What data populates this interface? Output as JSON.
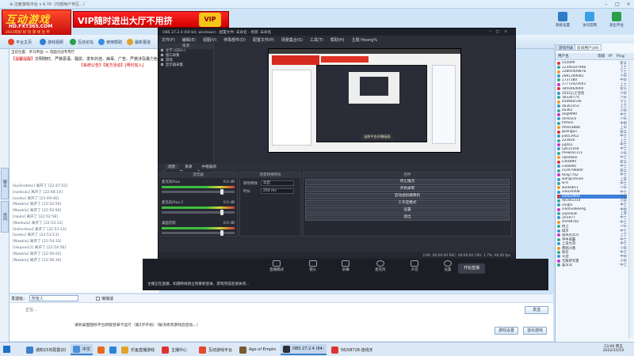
{
  "window": {
    "title": "⊕ 注册游戏平台 v 4.70（内部用户专区...）"
  },
  "brand": {
    "logo_text": "互动游戏",
    "logo_url": "HD.FXT365.COM",
    "logo_slogan": "2023年好 好 玩 游 戏 出 平",
    "banner_text": "VIP随时进出大厅不用挤",
    "banner_badge": "VIP"
  },
  "nav": {
    "items": [
      {
        "label": "平台主页",
        "color": "#e5482c"
      },
      {
        "label": "游戏视频",
        "color": "#2c7fd3"
      },
      {
        "label": "互动论坛",
        "color": "#2c9f4b"
      },
      {
        "label": "使用帮助",
        "color": "#3a8ee0"
      },
      {
        "label": "最新报道",
        "color": "#e0a32a"
      }
    ]
  },
  "top_right": [
    {
      "label": "系统设置"
    },
    {
      "label": "访问官网"
    },
    {
      "label": "退出平台"
    }
  ],
  "room": {
    "breadcrumb": "当前位置：罗马帝国 -> 电脑对战专用厅",
    "notice_label": "【温馨提醒】",
    "notice_text": "文明随时、严禁恶语、骚扰、发布外挂、病毒、广告、严禁涉及暴力色情、违反者将封号处理！",
    "notice_red": "【系统公告】【官方活动】[明日加入]",
    "left_tabs": [
      "聊天",
      "房间"
    ],
    "chat": [
      "[kuilinebloc] 离开了 [22:47:52]",
      "[nankulu] 离开了 [22:48:14]",
      "[sooku] 离开了 [22:49:46]",
      "[Nawklu] 离开了 [22:52:56]",
      "[Nawklu] 离开了 [22:52:56]",
      "[nkulo] 离开了 [22:52:58]",
      "[Nankulu] 离开了 [22:53:12]",
      "[lisklunkau] 离开了 [22:53:13]",
      "[sooku] 离开了 [22:53:13]",
      "[Nawklu] 离开了 [22:54:33]",
      "[nkupoo11] 离开了 [22:54:56]",
      "[Nawklu] 离开了 [22:56:02]",
      "[Nawklu] 离开了 [22:56:34]"
    ]
  },
  "sendbar": {
    "to_label": "发送给：",
    "to_value": "所有人",
    "private_label": "悄悄话",
    "send_label": "发送"
  },
  "inputarea": {
    "status_text": "正在...",
    "room_info": "请到桌面图标平台新版登录卡运行（第2步开始）（解决修改游戏后启动...）",
    "room_btn1": "游戏设置",
    "room_btn2": "退出游戏"
  },
  "right_panel": {
    "tabs": [
      "游戏列表",
      "房间用户(49)"
    ],
    "head": [
      "用户名",
      "等级",
      "IP",
      "Ping"
    ],
    "users": [
      {
        "name": "555009",
        "lv": "新兵",
        "color": "#d33"
      },
      {
        "name": "12340207998",
        "lv": "上士",
        "color": "#3a9"
      },
      {
        "name": "12805409878",
        "lv": "下士",
        "color": "#e92"
      },
      {
        "name": "2891309082",
        "lv": "少校",
        "color": "#39c"
      },
      {
        "name": "1737180",
        "lv": "中尉",
        "color": "#3a9"
      },
      {
        "name": "17772421603",
        "lv": "上士",
        "color": "#c3c"
      },
      {
        "name": "1850464000",
        "lv": "新兵",
        "color": "#d33"
      },
      {
        "name": "2022心之泡泡",
        "lv": "少校",
        "color": "#39c"
      },
      {
        "name": "38326774",
        "lv": "少校",
        "color": "#3a9"
      },
      {
        "name": "450660536",
        "lv": "下士",
        "color": "#e92"
      },
      {
        "name": "a6361553",
        "lv": "上士",
        "color": "#39c"
      },
      {
        "name": "aa362",
        "lv": "少校",
        "color": "#3a9"
      },
      {
        "name": "ang9999",
        "lv": "中士",
        "color": "#c3c"
      },
      {
        "name": "dcmoica",
        "lv": "少校",
        "color": "#39c"
      },
      {
        "name": "flsmen",
        "lv": "中尉",
        "color": "#3a9"
      },
      {
        "name": "flmoca888",
        "lv": "上等",
        "color": "#e92"
      },
      {
        "name": "guangyu",
        "lv": "新兵",
        "color": "#d33"
      },
      {
        "name": "jia653952",
        "lv": "中士",
        "color": "#39c"
      },
      {
        "name": "223834",
        "lv": "上士",
        "color": "#3a9"
      },
      {
        "name": "jupto1",
        "lv": "中士",
        "color": "#c3c"
      },
      {
        "name": "Lp615160",
        "lv": "中士",
        "color": "#39c"
      },
      {
        "name": "mewsa1111",
        "lv": "少校",
        "color": "#3a9"
      },
      {
        "name": "njkotaiko",
        "lv": "中士",
        "color": "#e92"
      },
      {
        "name": "s3kk890",
        "lv": "新兵",
        "color": "#d33"
      },
      {
        "name": "s3s8000",
        "lv": "中士",
        "color": "#39c"
      },
      {
        "name": "s1x9796600",
        "lv": "新兵",
        "color": "#3a9"
      },
      {
        "name": "tong7762",
        "lv": "中士",
        "color": "#c3c"
      },
      {
        "name": "wangl.zhuan",
        "lv": "上等",
        "color": "#39c"
      },
      {
        "name": "w-6",
        "lv": "中士",
        "color": "#3a9"
      },
      {
        "name": "wudaib11",
        "lv": "少校",
        "color": "#e92"
      },
      {
        "name": "xiao26408",
        "lv": "中士",
        "color": "#39c"
      },
      {
        "name": "xj0020904",
        "lv": "中士",
        "color": "#d33",
        "highlight": true
      },
      {
        "name": "XJC661314",
        "lv": "少校",
        "color": "#3a9"
      },
      {
        "name": "xingfu",
        "lv": "中士",
        "color": "#39c"
      },
      {
        "name": "xiaohuakeeng",
        "lv": "中尉",
        "color": "#c3c"
      },
      {
        "name": "yupanjiai",
        "lv": "上等",
        "color": "#3a9"
      },
      {
        "name": "ZR1977",
        "lv": "中士",
        "color": "#39c"
      },
      {
        "name": "zhiht8782",
        "lv": "中士",
        "color": "#e92"
      },
      {
        "name": "倒上",
        "lv": "少校",
        "color": "#3a9"
      },
      {
        "name": "城市",
        "lv": "中士",
        "color": "#39c"
      },
      {
        "name": "南风有云鸟",
        "lv": "上士",
        "color": "#c3c"
      },
      {
        "name": "手中采霸",
        "lv": "中士",
        "color": "#3a9"
      },
      {
        "name": "上海大哥",
        "lv": "中士",
        "color": "#39c"
      },
      {
        "name": "寒鸦冷香",
        "lv": "少校",
        "color": "#e92"
      },
      {
        "name": "秋云",
        "lv": "中士",
        "color": "#3a9"
      },
      {
        "name": "天边",
        "lv": "中尉",
        "color": "#39c"
      },
      {
        "name": "无敌将军雷",
        "lv": "少校",
        "color": "#c3c"
      },
      {
        "name": "喜洋洋",
        "lv": "中士",
        "color": "#3a9"
      }
    ]
  },
  "obs": {
    "title": "OBS 27.2.4 (64-bit, windows) - 配置文件: 未命名 - 场景: 未命名",
    "menu": [
      "文件(F)",
      "编辑(E)",
      "视图(V)",
      "停靠部件(D)",
      "配置文件(P)",
      "场景集合(S)",
      "工具(T)",
      "帮助(H)",
      "主题 Hoong%"
    ],
    "dock_title": "来源",
    "sources": [
      "文字 (GDI+)",
      "窗口采集",
      "游戏",
      "显示器采集"
    ],
    "panel_tabs": [
      "场景",
      "来源",
      "中继器源"
    ],
    "controls_bar": [
      "混音器",
      "场景转换特效",
      "控件"
    ],
    "mixer": [
      {
        "label": "麦克风/Aux",
        "db": "0.0 dB"
      },
      {
        "label": "麦克风/Aux 2",
        "db": "0.0 dB"
      },
      {
        "label": "桌面音频",
        "db": "0.0 dB"
      }
    ],
    "transition": {
      "label": "转场特效",
      "type": "淡出",
      "duration_label": "时长",
      "duration": "250 ms"
    },
    "controls": [
      "停止推流",
      "开始录制",
      "启动虚拟摄像机",
      "工作室模式",
      "设置",
      "退出"
    ],
    "preview_caption": "当前平台开播画面",
    "status": "LIVE: 00:00:00   REC: 00:00:00   CPU: 1.7%, 60.00 fps"
  },
  "live_strip": {
    "items": [
      "直播模式",
      "镜头",
      "屏幕",
      "麦克风",
      "声音",
      "设置"
    ],
    "start": "开始直播",
    "tip": "主播正在直播，如遇断线请立刻重新登录，游戏完成后请关闭..."
  },
  "taskbar": {
    "apps": [
      {
        "label": "通知15年配置识别",
        "color": "#3b7fc9"
      },
      {
        "label": "中文 ●",
        "color": "#4a90d9",
        "active": true
      },
      {
        "label": "",
        "color": "#e36b1e"
      },
      {
        "label": "",
        "color": "#2a84d6"
      },
      {
        "label": "乐鱼直播游戏",
        "color": "#e0a32a"
      },
      {
        "label": "主播中心",
        "color": "#d33"
      },
      {
        "label": "互动游戏平台 ...",
        "color": "#e5482c"
      },
      {
        "label": "Age of Empires E...",
        "color": "#7a5a2e"
      },
      {
        "label": "OBS 27.2.4 (64-bit...",
        "color": "#2b2e38",
        "active": true
      },
      {
        "label": "56/08728-连线天...",
        "color": "#d33"
      }
    ],
    "time": "23:00 周五",
    "date": "2022/10/14"
  }
}
